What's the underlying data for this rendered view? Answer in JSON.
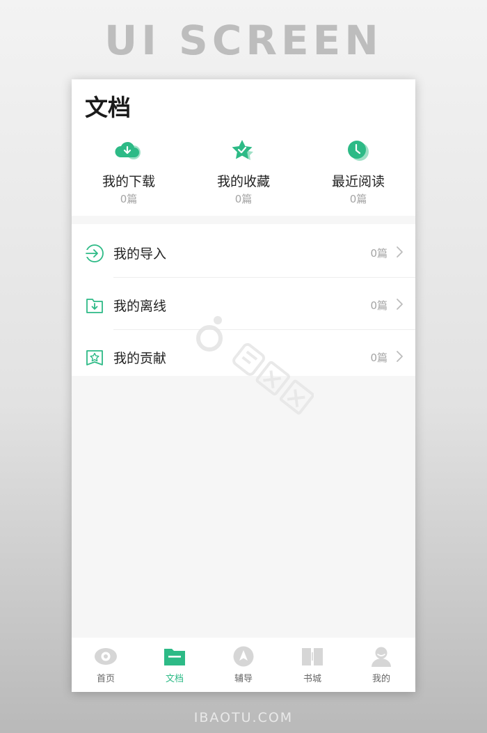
{
  "banner": {
    "top_text": "UI SCREEN",
    "bottom_text": "IBAOTU.COM"
  },
  "page": {
    "title": "文档"
  },
  "quick_actions": [
    {
      "label": "我的下载",
      "count": "0篇",
      "icon": "cloud-download-icon"
    },
    {
      "label": "我的收藏",
      "count": "0篇",
      "icon": "star-check-icon"
    },
    {
      "label": "最近阅读",
      "count": "0篇",
      "icon": "clock-icon"
    }
  ],
  "list": [
    {
      "label": "我的导入",
      "count": "0篇",
      "icon": "import-arrow-icon"
    },
    {
      "label": "我的离线",
      "count": "0篇",
      "icon": "folder-download-icon"
    },
    {
      "label": "我的贡献",
      "count": "0篇",
      "icon": "flag-star-icon"
    }
  ],
  "tabbar": [
    {
      "label": "首页",
      "icon": "eye-icon",
      "active": false
    },
    {
      "label": "文档",
      "icon": "folder-icon",
      "active": true
    },
    {
      "label": "辅导",
      "icon": "compass-icon",
      "active": false
    },
    {
      "label": "书城",
      "icon": "book-icon",
      "active": false
    },
    {
      "label": "我的",
      "icon": "user-icon",
      "active": false
    }
  ],
  "colors": {
    "accent": "#2dba86",
    "accent_light": "#9fe0c6",
    "inactive_icon": "#d6d6d6",
    "text_primary": "#222222",
    "text_secondary": "#a4a4a4"
  }
}
